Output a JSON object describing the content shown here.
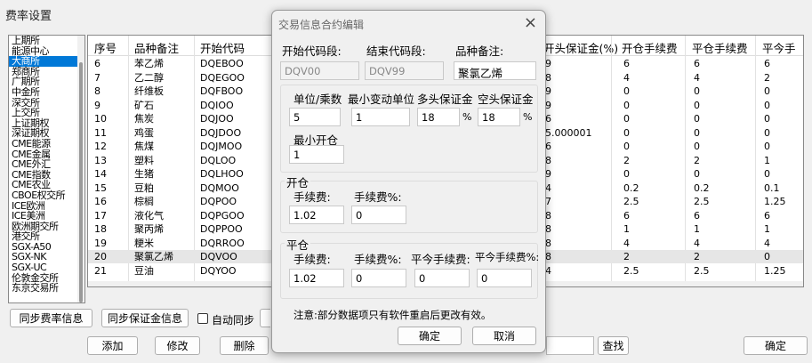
{
  "window": {
    "title": "费率设置"
  },
  "exchanges": {
    "items": [
      "上期所",
      "能源中心",
      "大商所",
      "郑商所",
      "广期所",
      "中金所",
      "深交所",
      "上交所",
      "上证期权",
      "深证期权",
      "CME能源",
      "CME金属",
      "CME外汇",
      "CME指数",
      "CME农业",
      "CBOE权交所",
      "ICE欧洲",
      "ICE美洲",
      "欧洲期交所",
      "港交所",
      "SGX-A50",
      "SGX-NK",
      "SGX-UC",
      "伦敦金交所",
      "东京交易所"
    ],
    "selected_index": 2
  },
  "grid": {
    "columns": [
      "序号",
      "品种备注",
      "开始代码",
      "",
      "开头保证金(%)",
      "开仓手续费",
      "平仓手续费",
      "平今手"
    ],
    "rows": [
      [
        "6",
        "苯乙烯",
        "DQEBOO",
        "9",
        "6",
        "6",
        "6"
      ],
      [
        "7",
        "乙二醇",
        "DQEGOO",
        "8",
        "4",
        "4",
        "2"
      ],
      [
        "8",
        "纤维板",
        "DQFBOO",
        "9",
        "0",
        "0",
        "0"
      ],
      [
        "9",
        "矿石",
        "DQIOO",
        "9",
        "0",
        "0",
        "0"
      ],
      [
        "10",
        "焦炭",
        "DQJOO",
        "6",
        "0",
        "0",
        "0"
      ],
      [
        "11",
        "鸡蛋",
        "DQJDOO",
        "5.000001",
        "0",
        "0",
        "0"
      ],
      [
        "12",
        "焦煤",
        "DQJMOO",
        "6",
        "0",
        "0",
        "0"
      ],
      [
        "13",
        "塑料",
        "DQLOO",
        "8",
        "2",
        "2",
        "1"
      ],
      [
        "14",
        "生猪",
        "DQLHOO",
        "9",
        "0",
        "0",
        "0"
      ],
      [
        "15",
        "豆粕",
        "DQMOO",
        "4",
        "0.2",
        "0.2",
        "0.1"
      ],
      [
        "16",
        "棕榈",
        "DQPOO",
        "7",
        "2.5",
        "2.5",
        "1.25"
      ],
      [
        "17",
        "液化气",
        "DQPGOO",
        "8",
        "6",
        "6",
        "6"
      ],
      [
        "18",
        "聚丙烯",
        "DQPPOO",
        "8",
        "1",
        "1",
        "1"
      ],
      [
        "19",
        "粳米",
        "DQRROO",
        "8",
        "4",
        "4",
        "4"
      ],
      [
        "20",
        "聚氯乙烯",
        "DQVOO",
        "8",
        "2",
        "2",
        "0"
      ],
      [
        "21",
        "豆油",
        "DQYOO",
        "4",
        "2.5",
        "2.5",
        "1.25"
      ]
    ],
    "selected_row": 14
  },
  "bottom": {
    "sync_fee_label": "同步费率信息",
    "sync_margin_label": "同步保证金信息",
    "auto_sync_label": "自动同步",
    "add_label": "添加",
    "modify_label": "修改",
    "delete_label": "删除",
    "find_label": "查找",
    "ok_label": "确定"
  },
  "dialog": {
    "title": "交易信息合约编辑",
    "start_code_label": "开始代码段:",
    "end_code_label": "结束代码段:",
    "remark_label": "品种备注:",
    "start_code": "DQV00",
    "end_code": "DQV99",
    "remark": "聚氯乙烯",
    "unit_label": "单位/乘数",
    "tick_label": "最小变动单位",
    "long_margin_label": "多头保证金",
    "short_margin_label": "空头保证金",
    "unit": "5",
    "tick": "1",
    "long_margin": "18",
    "short_margin": "18",
    "pct": "%",
    "min_open_label": "最小开仓",
    "min_open": "1",
    "open_group": "开仓",
    "open_fee_label": "手续费:",
    "open_fee_pct_label": "手续费%:",
    "open_fee": "1.02",
    "open_fee_pct": "0",
    "close_group": "平仓",
    "close_fee_label": "手续费:",
    "close_fee_pct_label": "手续费%:",
    "close_today_fee_label": "平今手续费:",
    "close_today_fee_pct_label": "平今手续费%:",
    "close_fee": "1.02",
    "close_fee_pct": "0",
    "close_today_fee": "0",
    "close_today_fee_pct": "0",
    "note": "注意:部分数据项只有软件重启后更改有效。",
    "ok_label": "确定",
    "cancel_label": "取消"
  }
}
